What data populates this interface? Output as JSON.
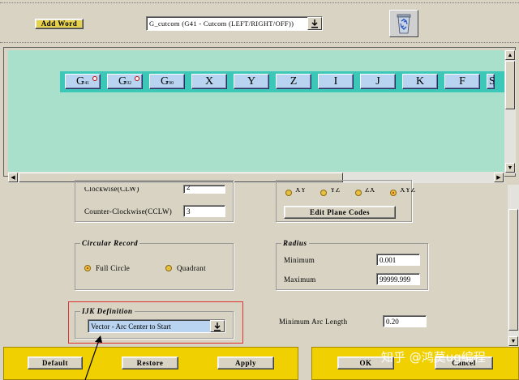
{
  "toolbar": {
    "add_word_label": "Add Word",
    "word_select_value": "G_cutcom  (G41 - Cutcom (LEFT/RIGHT/OFF))",
    "trash_icon": "recycle-bin-icon"
  },
  "word_panel": {
    "words": [
      {
        "main": "G",
        "sub": "41",
        "mandatory": true
      },
      {
        "main": "G",
        "sub": "02",
        "mandatory": true
      },
      {
        "main": "G",
        "sub": "90",
        "mandatory": false
      },
      {
        "main": "X",
        "sub": "",
        "mandatory": false
      },
      {
        "main": "Y",
        "sub": "",
        "mandatory": false
      },
      {
        "main": "Z",
        "sub": "",
        "mandatory": false
      },
      {
        "main": "I",
        "sub": "",
        "mandatory": false
      },
      {
        "main": "J",
        "sub": "",
        "mandatory": false
      },
      {
        "main": "K",
        "sub": "",
        "mandatory": false
      },
      {
        "main": "F",
        "sub": "",
        "mandatory": false
      },
      {
        "main": "S",
        "sub": "",
        "mandatory": false
      }
    ],
    "colors": {
      "background": "#a8e0cc",
      "strip": "#3cc8b8",
      "word": "#b8d4f0"
    }
  },
  "form": {
    "clockwise_label": "Clockwise(CLW)",
    "clockwise_value": "2",
    "ccw_label": "Counter-Clockwise(CCLW)",
    "ccw_value": "3",
    "planes": [
      "XY",
      "YZ",
      "ZX",
      "XYZ"
    ],
    "edit_plane_codes_label": "Edit Plane Codes",
    "circular_record": {
      "title": "Circular Record",
      "options": [
        "Full Circle",
        "Quadrant"
      ],
      "selected": "Full Circle"
    },
    "radius": {
      "title": "Radius",
      "minimum_label": "Minimum",
      "minimum_value": "0.001",
      "maximum_label": "Maximum",
      "maximum_value": "99999.999"
    },
    "ijk": {
      "title": "IJK Definition",
      "value": "Vector - Arc Center to Start"
    },
    "min_arc_length_label": "Minimum Arc Length",
    "min_arc_length_value": "0.20"
  },
  "buttons": {
    "default": "Default",
    "restore": "Restore",
    "apply": "Apply",
    "ok": "OK",
    "cancel": "Cancel"
  },
  "watermark": "知乎 @鸿莫ug编程",
  "colors": {
    "dialog": "#d8d3c3",
    "bottom_bar": "#f0d000",
    "annotation": "#e03030"
  }
}
